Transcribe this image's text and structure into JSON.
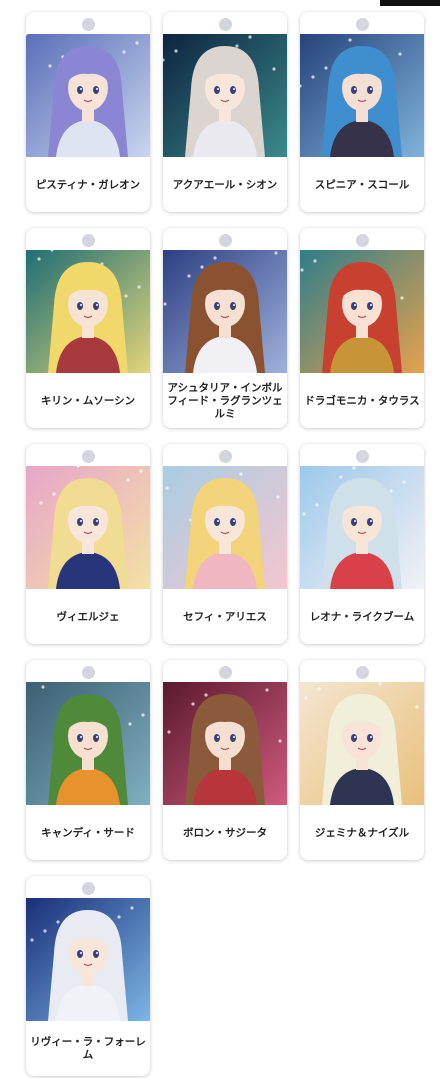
{
  "characters": [
    {
      "name": "ピスティナ・ガレオン",
      "art": {
        "bg1": "#5a6fb8",
        "bg2": "#c9d6ef",
        "hair": "#8a86d4",
        "skin": "#f6e2d6",
        "outfit": "#dfe4f2"
      }
    },
    {
      "name": "アクアエール・シオン",
      "art": {
        "bg1": "#0d2440",
        "bg2": "#3b8a8a",
        "hair": "#dcd4cf",
        "skin": "#f7e6da",
        "outfit": "#e9e9ef"
      }
    },
    {
      "name": "スピニア・スコール",
      "art": {
        "bg1": "#27437a",
        "bg2": "#7fb4dc",
        "hair": "#3f8fd0",
        "skin": "#f4dfd4",
        "outfit": "#35324a"
      }
    },
    {
      "name": "キリン・ムソーシン",
      "art": {
        "bg1": "#1f6e74",
        "bg2": "#e2d57a",
        "hair": "#f0d86a",
        "skin": "#f6e3d4",
        "outfit": "#a83a3e"
      }
    },
    {
      "name": "アシュタリア・インボルフィード・ラグランツェルミ",
      "art": {
        "bg1": "#2c3f83",
        "bg2": "#9fb2dc",
        "hair": "#8a5230",
        "skin": "#f6e0d2",
        "outfit": "#f1f1f5"
      }
    },
    {
      "name": "ドラゴモニカ・タウラス",
      "art": {
        "bg1": "#2f7d8a",
        "bg2": "#e6a24c",
        "hair": "#c8402f",
        "skin": "#f6e1d3",
        "outfit": "#c79538"
      }
    },
    {
      "name": "ヴィエルジェ",
      "art": {
        "bg1": "#e7a6c9",
        "bg2": "#f3e1a4",
        "hair": "#f0dc93",
        "skin": "#f8e6da",
        "outfit": "#28357a"
      }
    },
    {
      "name": "セフィ・アリエス",
      "art": {
        "bg1": "#a9cde3",
        "bg2": "#f4c6cf",
        "hair": "#f3d47a",
        "skin": "#f8e6d9",
        "outfit": "#f0b7c0"
      }
    },
    {
      "name": "レオナ・ライクブーム",
      "art": {
        "bg1": "#9dc8ea",
        "bg2": "#f3f1f6",
        "hair": "#cfe0ea",
        "skin": "#f7e5d8",
        "outfit": "#d8404a"
      }
    },
    {
      "name": "キャンディ・サード",
      "art": {
        "bg1": "#3d5f72",
        "bg2": "#7fb0c1",
        "hair": "#4f8a3a",
        "skin": "#f6e0cf",
        "outfit": "#e7922d"
      }
    },
    {
      "name": "ボロン・サジータ",
      "art": {
        "bg1": "#5a1a2e",
        "bg2": "#d05a7e",
        "hair": "#8a5a3a",
        "skin": "#f5dfd0",
        "outfit": "#b7363b"
      }
    },
    {
      "name": "ジェミナ＆ナイズル",
      "art": {
        "bg1": "#f4e6d2",
        "bg2": "#e8c07a",
        "hair": "#f1eed9",
        "skin": "#f7e4d6",
        "outfit": "#2d3552"
      }
    },
    {
      "name": "リヴィー・ラ・フォーレム",
      "art": {
        "bg1": "#1a2f78",
        "bg2": "#7cb6e6",
        "hair": "#e8ebf2",
        "skin": "#f7e6da",
        "outfit": "#f0f2f8"
      }
    }
  ]
}
